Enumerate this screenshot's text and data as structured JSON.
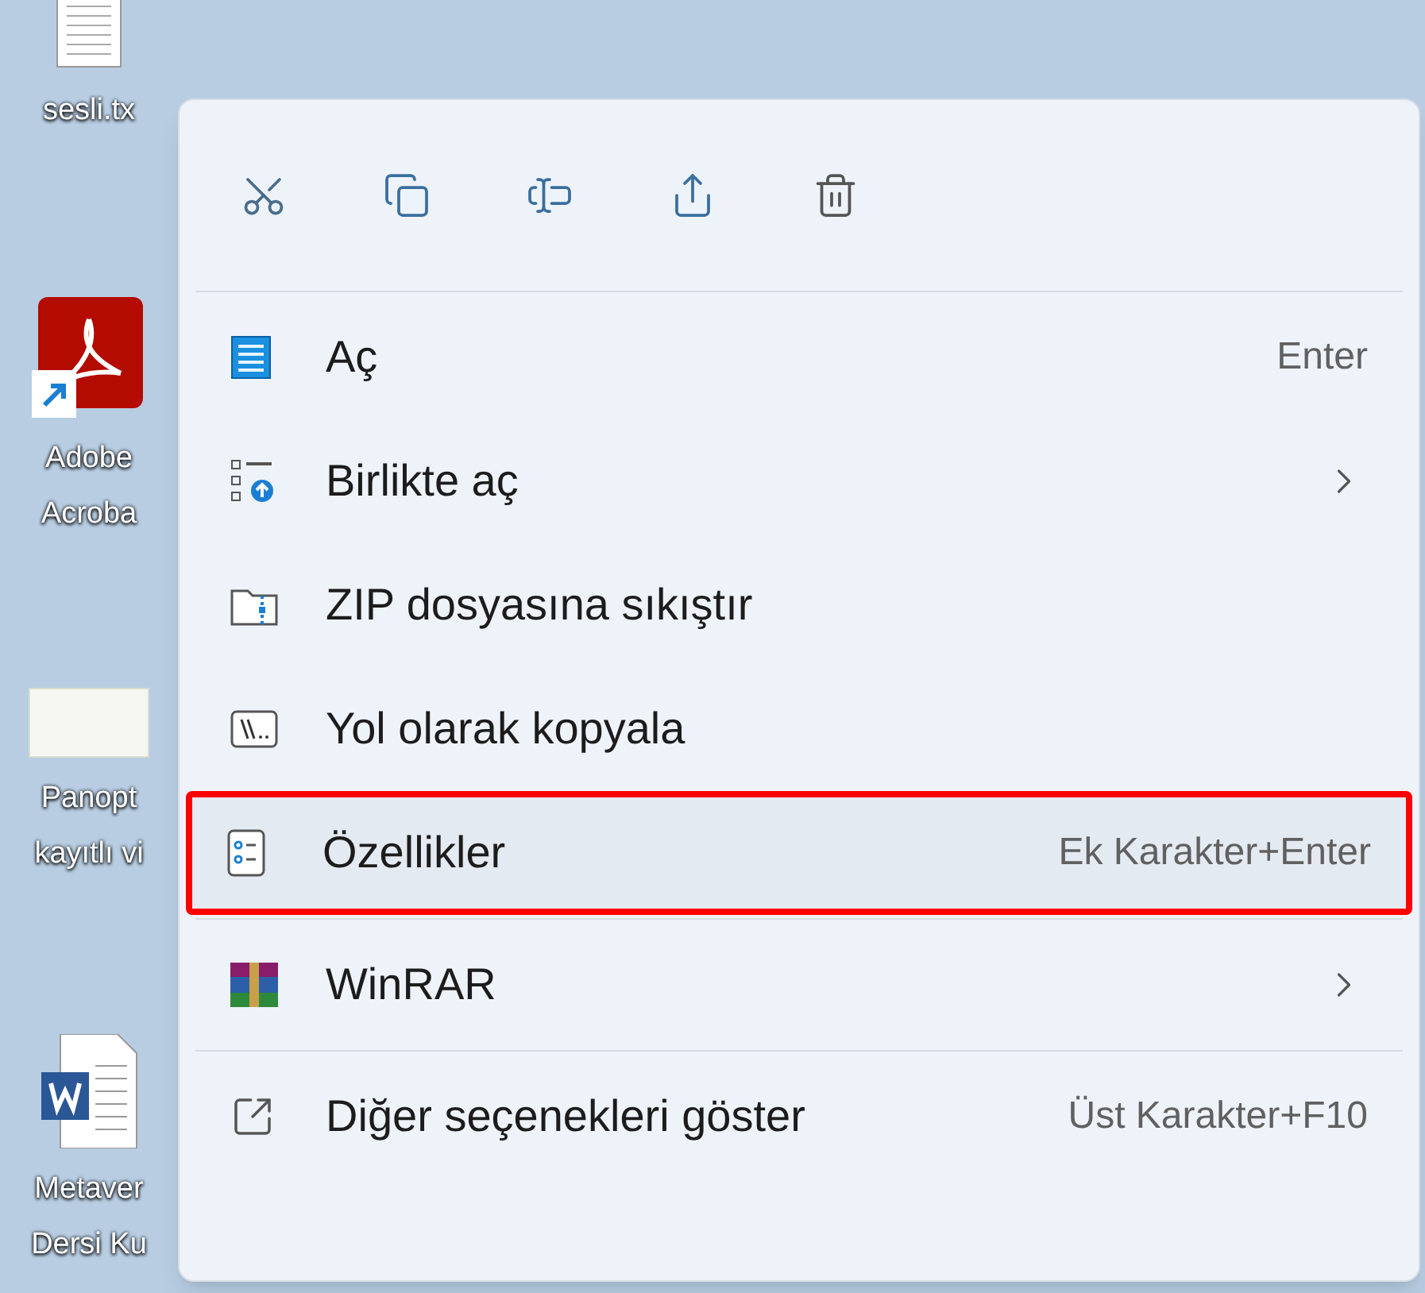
{
  "desktop_icons": [
    {
      "kind": "text-file",
      "lines": [
        "sesli.tx"
      ]
    },
    {
      "kind": "pdf-shortcut",
      "lines": [
        "Adobe",
        "Acroba"
      ]
    },
    {
      "kind": "video-thumbnail",
      "lines": [
        "Panopt",
        "kayıtlı vi"
      ]
    },
    {
      "kind": "word-document",
      "lines": [
        "Metaver",
        "Dersi Ku"
      ]
    }
  ],
  "context_menu": {
    "toolbar": [
      {
        "kind": "cut"
      },
      {
        "kind": "copy"
      },
      {
        "kind": "rename"
      },
      {
        "kind": "share"
      },
      {
        "kind": "delete"
      }
    ],
    "sections": [
      {
        "items": [
          {
            "kind": "notepad",
            "label": "Aç",
            "shortcut": "Enter",
            "submenu": false,
            "highlighted": false
          },
          {
            "kind": "open-with",
            "label": "Birlikte aç",
            "submenu": true,
            "highlighted": false
          },
          {
            "kind": "zip-folder",
            "label": "ZIP dosyasına sıkıştır",
            "submenu": false,
            "highlighted": false
          },
          {
            "kind": "path",
            "label": "Yol olarak kopyala",
            "submenu": false,
            "highlighted": false
          },
          {
            "kind": "properties",
            "label": "Özellikler",
            "shortcut": "Ek Karakter+Enter",
            "submenu": false,
            "highlighted": true
          }
        ]
      },
      {
        "items": [
          {
            "kind": "winrar",
            "label": "WinRAR",
            "submenu": true,
            "highlighted": false
          }
        ]
      },
      {
        "items": [
          {
            "kind": "more-options",
            "label": "Diğer seçenekleri göster",
            "shortcut": "Üst Karakter+F10",
            "submenu": false,
            "highlighted": false
          }
        ]
      }
    ]
  }
}
